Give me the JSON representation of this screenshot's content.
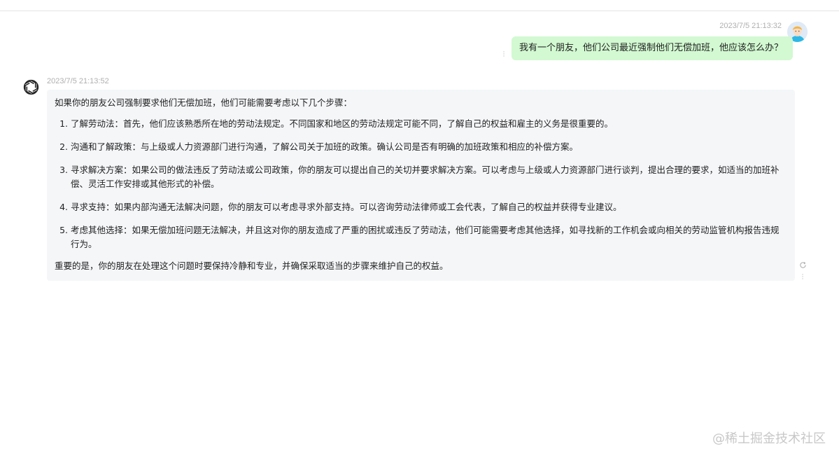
{
  "user_message": {
    "timestamp": "2023/7/5 21:13:32",
    "text": "我有一个朋友，他们公司最近强制他们无偿加班，他应该怎么办？",
    "avatar_icon": "user-avatar-icon",
    "bubble_color": "#d2f9d1"
  },
  "assistant_message": {
    "timestamp": "2023/7/5 21:13:52",
    "logo_icon": "openai-logo-icon",
    "intro": "如果你的朋友公司强制要求他们无偿加班，他们可能需要考虑以下几个步骤：",
    "steps": [
      "了解劳动法：首先，他们应该熟悉所在地的劳动法规定。不同国家和地区的劳动法规定可能不同，了解自己的权益和雇主的义务是很重要的。",
      "沟通和了解政策：与上级或人力资源部门进行沟通，了解公司关于加班的政策。确认公司是否有明确的加班政策和相应的补偿方案。",
      "寻求解决方案：如果公司的做法违反了劳动法或公司政策，你的朋友可以提出自己的关切并要求解决方案。可以考虑与上级或人力资源部门进行谈判，提出合理的要求，如适当的加班补偿、灵活工作安排或其他形式的补偿。",
      "寻求支持：如果内部沟通无法解决问题，你的朋友可以考虑寻求外部支持。可以咨询劳动法律师或工会代表，了解自己的权益并获得专业建议。",
      "考虑其他选择：如果无偿加班问题无法解决，并且这对你的朋友造成了严重的困扰或违反了劳动法，他们可能需要考虑其他选择，如寻找新的工作机会或向相关的劳动监管机构报告违规行为。"
    ],
    "outro": "重要的是，你的朋友在处理这个问题时要保持冷静和专业，并确保采取适当的步骤来维护自己的权益。",
    "bubble_color": "#f4f6f8"
  },
  "actions": {
    "regenerate_icon": "refresh-icon",
    "more_icon": "more-vertical-icon"
  },
  "watermark": "@稀土掘金技术社区"
}
